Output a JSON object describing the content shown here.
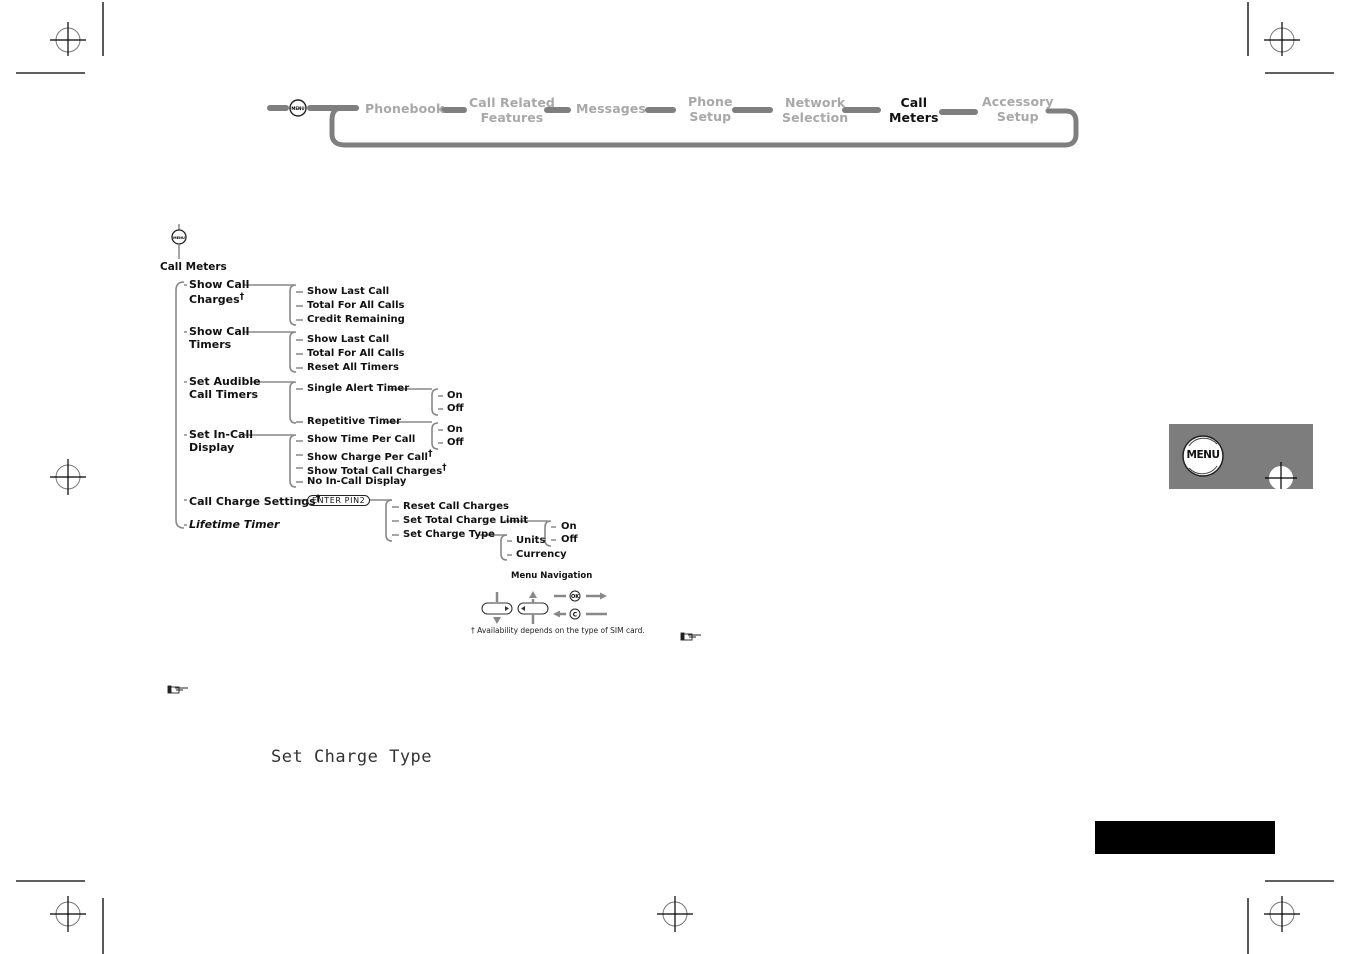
{
  "breadcrumb_nav": {
    "menu_icon": "menu-button-icon",
    "items": [
      {
        "label_line1": "Phonebook",
        "label_line2": "",
        "active": false
      },
      {
        "label_line1": "Call Related",
        "label_line2": "Features",
        "active": false
      },
      {
        "label_line1": "Messages",
        "label_line2": "",
        "active": false
      },
      {
        "label_line1": "Phone",
        "label_line2": "Setup",
        "active": false
      },
      {
        "label_line1": "Network",
        "label_line2": "Selection",
        "active": false
      },
      {
        "label_line1": "Call",
        "label_line2": "Meters",
        "active": true
      },
      {
        "label_line1": "Accessory",
        "label_line2": "Setup",
        "active": false
      }
    ],
    "colors": {
      "inactive_text": "#a8a8a8",
      "active_text": "#111111",
      "connector": "#7f7f7f"
    }
  },
  "menu_tree": {
    "root": "Call Meters",
    "dagger": "†",
    "nodes": {
      "show_call_charges": {
        "line1": "Show Call",
        "line2": "Charges",
        "children": [
          "Show Last Call",
          "Total For All Calls",
          "Credit Remaining"
        ]
      },
      "show_call_timers": {
        "line1": "Show Call",
        "line2": "Timers",
        "children": [
          "Show Last Call",
          "Total For All Calls",
          "Reset All Timers"
        ]
      },
      "set_audible_call_timers": {
        "line1": "Set Audible",
        "line2": "Call Timers",
        "children": [
          {
            "label": "Single Alert Timer",
            "options": [
              "On",
              "Off"
            ]
          },
          {
            "label": "Repetitive Timer",
            "options": [
              "On",
              "Off"
            ]
          }
        ]
      },
      "set_in_call_display": {
        "line1": "Set In-Call",
        "line2": "Display",
        "children": [
          "Show Time Per Call",
          "Show Charge Per Call",
          "Show Total Call Charges",
          "No In-Call Display"
        ]
      },
      "call_charge_settings": {
        "label": "Call Charge Settings",
        "pin_prompt": "ENTER PIN2",
        "children": [
          {
            "label": "Reset Call Charges"
          },
          {
            "label": "Set Total Charge Limit",
            "options": [
              "On",
              "Off"
            ]
          },
          {
            "label": "Set Charge Type",
            "options": [
              "Units",
              "Currency"
            ]
          }
        ]
      },
      "lifetime_timer": {
        "label": "Lifetime Timer"
      }
    }
  },
  "menu_navigation": {
    "title": "Menu Navigation",
    "ok_label": "OK",
    "c_label": "C",
    "footnote": "†  Availability depends on the type of SIM card."
  },
  "lcd_display": {
    "text": "Set Charge Type"
  },
  "side_tab": {
    "label": "MENU",
    "bg_color": "#7d7d7d"
  },
  "icons": {
    "note_pointer": "pointing-hand-icon"
  }
}
